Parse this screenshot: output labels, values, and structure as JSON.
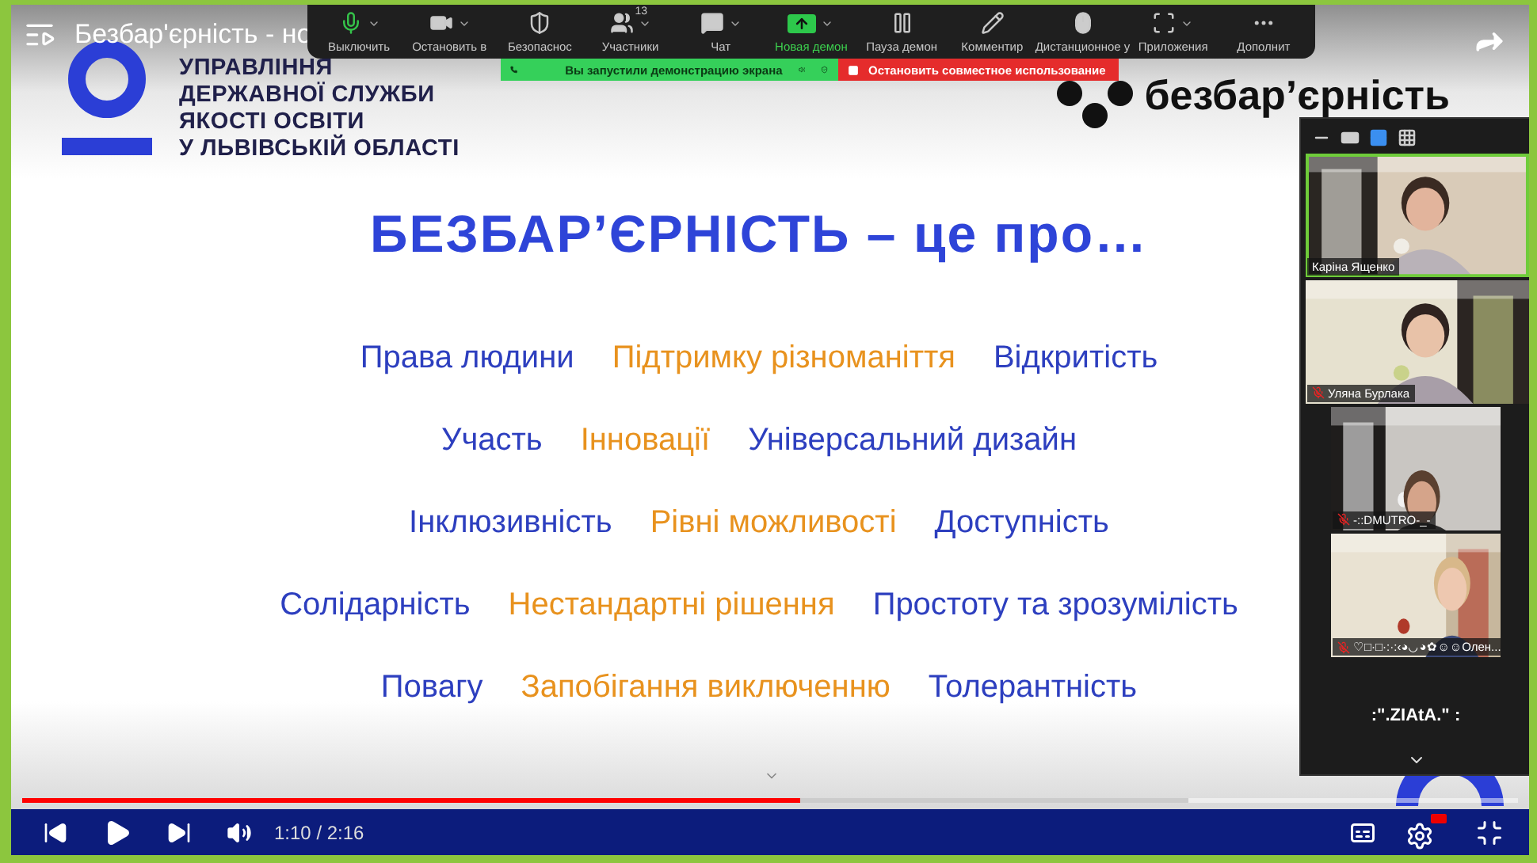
{
  "player": {
    "title": "Безбар'єрність - но",
    "time": "1:10 / 2:16",
    "level": 0.52
  },
  "zoom_toolbar": [
    {
      "kind": "mic",
      "label": "Выключить",
      "menu": true,
      "selected": false
    },
    {
      "kind": "video",
      "label": "Остановить в",
      "menu": true,
      "selected": false
    },
    {
      "kind": "shield",
      "label": "Безопаснос",
      "menu": false,
      "selected": false
    },
    {
      "kind": "people",
      "label": "Участники",
      "menu": true,
      "count": "13",
      "selected": false
    },
    {
      "kind": "chat",
      "label": "Чат",
      "menu": true,
      "selected": false
    },
    {
      "kind": "share",
      "label": "Новая демон",
      "menu": true,
      "selected": true
    },
    {
      "kind": "pause",
      "label": "Пауза демон",
      "menu": false,
      "selected": false
    },
    {
      "kind": "pen",
      "label": "Комментир",
      "menu": false,
      "selected": false
    },
    {
      "kind": "mouse",
      "label": "Дистанционное у",
      "menu": false,
      "selected": false
    },
    {
      "kind": "apps",
      "label": "Приложения",
      "menu": true,
      "selected": false
    },
    {
      "kind": "more",
      "label": "Дополнит",
      "menu": false,
      "selected": false
    }
  ],
  "share_banner": {
    "text": "Вы запустили демонстрацию экрана",
    "stop_button": "Остановить совместное использование"
  },
  "slide": {
    "org": [
      "УПРАВЛІННЯ",
      "ДЕРЖАВНОЇ СЛУЖБИ",
      "ЯКОСТІ ОСВІТИ",
      "У ЛЬВІВСЬКІЙ ОБЛАСТІ"
    ],
    "brand": "безбар’єрність",
    "heading": "БЕЗБАР’ЄРНІСТЬ – це про…",
    "rows": [
      [
        {
          "text": "Права людини",
          "color": "#2d3fbf"
        },
        {
          "text": "Підтримку різноманіття",
          "color": "#e8921e"
        },
        {
          "text": "Відкритість",
          "color": "#2d3fbf"
        }
      ],
      [
        {
          "text": "Участь",
          "color": "#2d3fbf"
        },
        {
          "text": "Інновації",
          "color": "#e8921e"
        },
        {
          "text": "Універсальний дизайн",
          "color": "#2d3fbf"
        }
      ],
      [
        {
          "text": "Інклюзивність",
          "color": "#2d3fbf"
        },
        {
          "text": "Рівні можливості",
          "color": "#e8921e"
        },
        {
          "text": "Доступність",
          "color": "#2d3fbf"
        }
      ],
      [
        {
          "text": "Солідарність",
          "color": "#2d3fbf"
        },
        {
          "text": "Нестандартні рішення",
          "color": "#e8921e"
        },
        {
          "text": "Простоту та зрозумілість",
          "color": "#2d3fbf"
        }
      ],
      [
        {
          "text": "Повагу",
          "color": "#2d3fbf"
        },
        {
          "text": "Запобігання виключенню",
          "color": "#e8921e"
        },
        {
          "text": "Толерантність",
          "color": "#2d3fbf"
        }
      ]
    ]
  },
  "participants": {
    "view_modes": [
      {
        "kind": "minimize",
        "selected": false
      },
      {
        "kind": "single",
        "selected": false
      },
      {
        "kind": "strip",
        "selected": true
      },
      {
        "kind": "grid",
        "selected": false
      }
    ],
    "tiles": [
      {
        "name": "Каріна Ященко",
        "muted": false,
        "speaking": true,
        "kind": "wide"
      },
      {
        "name": "Уляна Бурлака",
        "muted": true,
        "speaking": false,
        "kind": "wide"
      },
      {
        "name": "-::DMUTRO-_-",
        "muted": true,
        "speaking": false,
        "kind": "narrow"
      },
      {
        "name": "♡□·□·:·:‹◕◡◕✿☺☺Олен...",
        "muted": true,
        "speaking": false,
        "kind": "narrow"
      }
    ],
    "footer_name": ":\".ZIAtA.\" :"
  }
}
